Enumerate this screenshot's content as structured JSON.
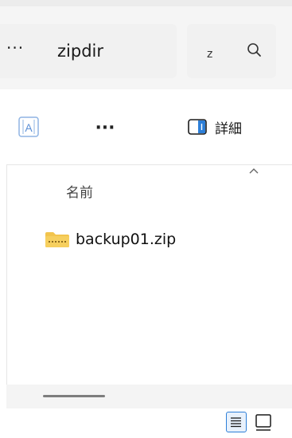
{
  "address_bar": {
    "overflow_label": "···",
    "path_text": "zipdir"
  },
  "search": {
    "text": "z",
    "icon": "search-icon"
  },
  "command_bar": {
    "translate_icon": "translate-icon",
    "more_label": "···",
    "details_label": "詳細",
    "details_icon": "details-pane-icon"
  },
  "file_list": {
    "column_header": "名前",
    "sort_indicator": "chevron-up-icon",
    "items": [
      {
        "name": "backup01.zip",
        "icon": "zip-folder-icon"
      }
    ]
  },
  "colors": {
    "accent": "#2d7fd8",
    "zip_folder": "#f2c44d"
  }
}
